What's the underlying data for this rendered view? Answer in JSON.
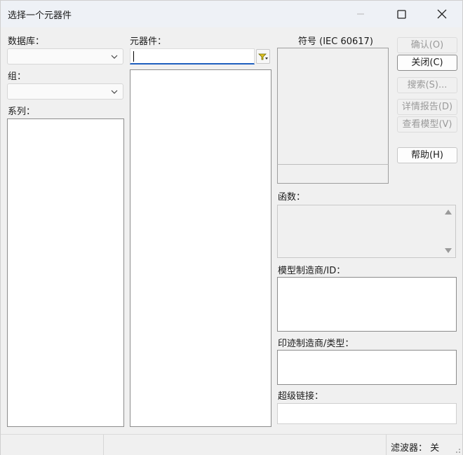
{
  "window": {
    "title": "选择一个元器件"
  },
  "left": {
    "database_label": "数据库：",
    "group_label": "组：",
    "family_label": "系列："
  },
  "middle": {
    "component_label": "元器件：",
    "search_value": ""
  },
  "right": {
    "symbol_label": "符号 (IEC 60617)",
    "function_label": "函数：",
    "model_label": "模型制造商/ID：",
    "footprint_label": "印迹制造商/类型：",
    "hyperlink_label": "超级链接："
  },
  "buttons": {
    "ok": "确认(O)",
    "close": "关闭(C)",
    "search": "搜索(S)...",
    "detail_report": "详情报告(D)",
    "view_model": "查看模型(V)",
    "help": "帮助(H)"
  },
  "status": {
    "filter": "滤波器：  关"
  },
  "icons": {
    "minimize": "minimize-icon",
    "maximize": "maximize-icon",
    "close": "close-icon",
    "filter": "filter-icon",
    "chevron": "chevron-down-icon"
  }
}
